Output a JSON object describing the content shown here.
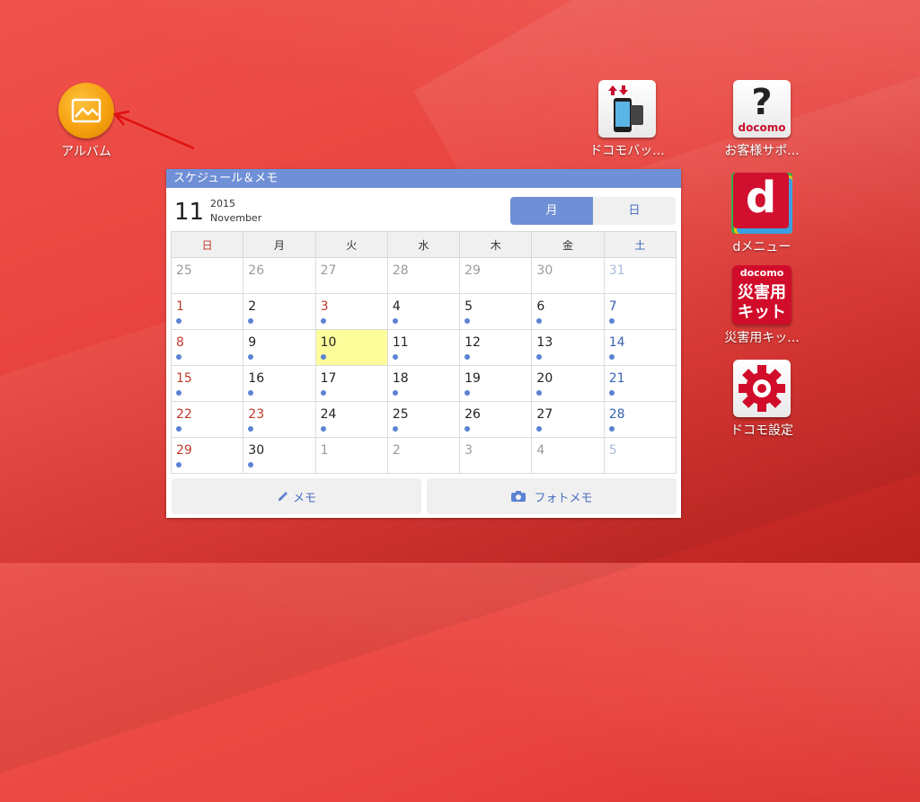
{
  "desktop": {
    "album": {
      "label": "アルバム"
    },
    "apps": [
      {
        "label": "ドコモバッ..."
      },
      {
        "label": "お客様サポ..."
      },
      {
        "label": "dメニュー"
      },
      {
        "label": "災害用キッ..."
      },
      {
        "label": "ドコモ設定"
      }
    ],
    "docomo_logo": "docomo",
    "d_letter": "d",
    "kit_line1": "災害用",
    "kit_line2": "キット",
    "help_glyph": "?"
  },
  "widget": {
    "title": "スケジュール＆メモ",
    "month_num": "11",
    "year": "2015",
    "month_name": "November",
    "view_toggle": [
      "月",
      "日"
    ],
    "weekdays": [
      "日",
      "月",
      "火",
      "水",
      "木",
      "金",
      "土"
    ],
    "weeks": [
      [
        "25",
        "26",
        "27",
        "28",
        "29",
        "30",
        "31"
      ],
      [
        "1",
        "2",
        "3",
        "4",
        "5",
        "6",
        "7"
      ],
      [
        "8",
        "9",
        "10",
        "11",
        "12",
        "13",
        "14"
      ],
      [
        "15",
        "16",
        "17",
        "18",
        "19",
        "20",
        "21"
      ],
      [
        "22",
        "23",
        "24",
        "25",
        "26",
        "27",
        "28"
      ],
      [
        "29",
        "30",
        "1",
        "2",
        "3",
        "4",
        "5"
      ]
    ],
    "memo_button": "メモ",
    "photo_memo_button": "フォトメモ"
  },
  "colors": {
    "accent": "#6f8fd6",
    "today_highlight": "#fdfd9c",
    "holiday": "#c0392b",
    "saturday": "#3a62b2",
    "wallpaper": "#e9443f"
  }
}
